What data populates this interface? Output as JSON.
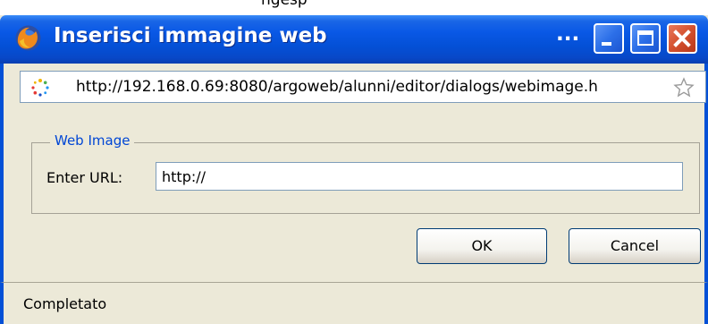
{
  "top_strip": {
    "text": "ngesp"
  },
  "window": {
    "title": "Inserisci immagine web",
    "title_ellipsis": "...",
    "icon": "firefox-icon"
  },
  "address_bar": {
    "url": "http://192.168.0.69:8080/argoweb/alunni/editor/dialogs/webimage.h",
    "loading_icon": "loading-spinner-icon",
    "star_icon": "bookmark-star-icon"
  },
  "dialog": {
    "legend": "Web Image",
    "url_label": "Enter URL:",
    "url_value": "http://",
    "ok_label": "OK",
    "cancel_label": "Cancel"
  },
  "status": {
    "text": "Completato"
  },
  "colors": {
    "titlebar": "#0450d6",
    "legend": "#0046d5",
    "face": "#ece9d8",
    "close_button": "#d4502e"
  }
}
